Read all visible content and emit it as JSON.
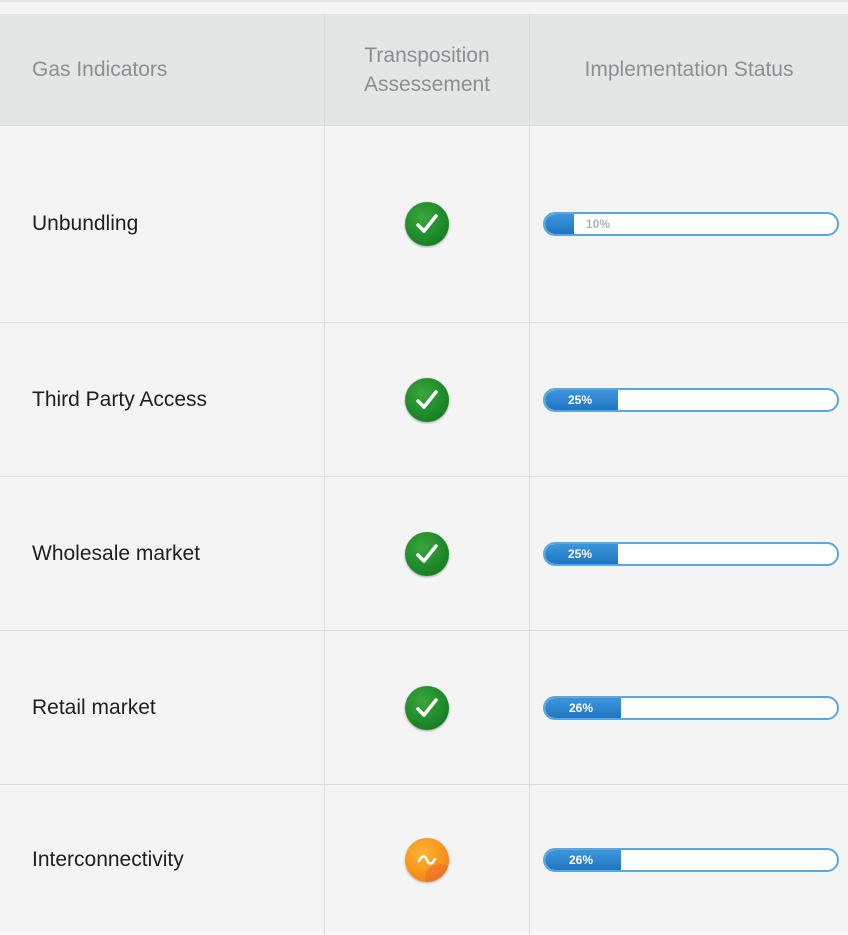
{
  "header": {
    "col_indicators": "Gas Indicators",
    "col_transposition_line1": "Transposition",
    "col_transposition_line2": "Assessement",
    "col_status": "Implementation Status"
  },
  "rows": [
    {
      "label": "Unbundling",
      "transposition": "check-icon",
      "progress_value": 10,
      "progress_label": "10%"
    },
    {
      "label": "Third Party Access",
      "transposition": "check-icon",
      "progress_value": 25,
      "progress_label": "25%"
    },
    {
      "label": "Wholesale market",
      "transposition": "check-icon",
      "progress_value": 25,
      "progress_label": "25%"
    },
    {
      "label": "Retail market",
      "transposition": "check-icon",
      "progress_value": 26,
      "progress_label": "26%"
    },
    {
      "label": "Interconnectivity",
      "transposition": "partial-icon",
      "progress_value": 26,
      "progress_label": "26%"
    }
  ],
  "colors": {
    "ok": "#1f8a2a",
    "partial": "#f7941d",
    "progress": "#1f76c2"
  }
}
